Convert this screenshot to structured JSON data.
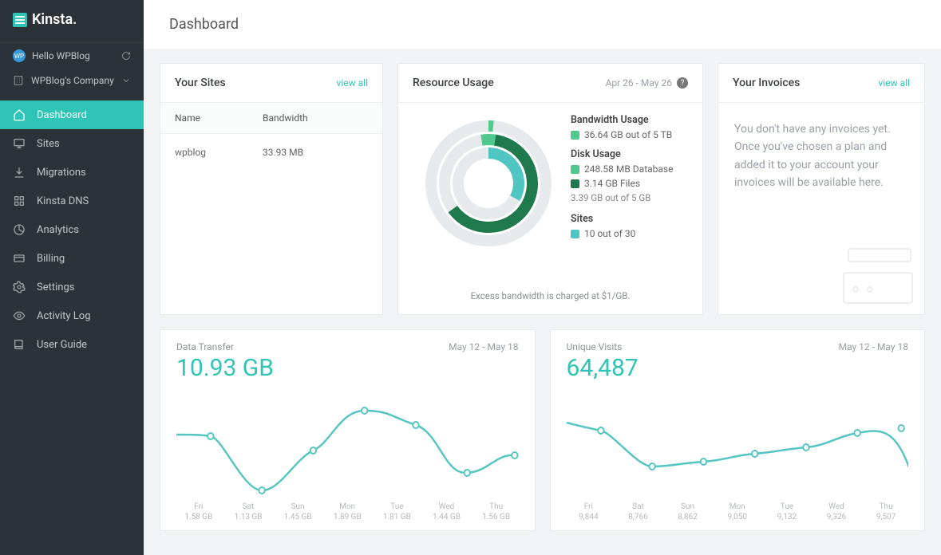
{
  "brand": {
    "name": "Kinsta."
  },
  "user": {
    "greeting": "Hello WPBlog",
    "company": "WPBlog's Company"
  },
  "nav": [
    {
      "id": "dashboard",
      "label": "Dashboard",
      "active": true
    },
    {
      "id": "sites",
      "label": "Sites",
      "active": false
    },
    {
      "id": "migrations",
      "label": "Migrations",
      "active": false
    },
    {
      "id": "kinsta-dns",
      "label": "Kinsta DNS",
      "active": false
    },
    {
      "id": "analytics",
      "label": "Analytics",
      "active": false
    },
    {
      "id": "billing",
      "label": "Billing",
      "active": false
    },
    {
      "id": "settings",
      "label": "Settings",
      "active": false
    },
    {
      "id": "activity-log",
      "label": "Activity Log",
      "active": false
    },
    {
      "id": "user-guide",
      "label": "User Guide",
      "active": false
    }
  ],
  "page_title": "Dashboard",
  "your_sites": {
    "title": "Your Sites",
    "link": "view all",
    "headers": {
      "name": "Name",
      "bandwidth": "Bandwidth"
    },
    "rows": [
      {
        "name": "wpblog",
        "bandwidth": "33.93 MB"
      }
    ]
  },
  "resource_usage": {
    "title": "Resource Usage",
    "range": "Apr 26 - May 26",
    "bandwidth": {
      "label": "Bandwidth Usage",
      "value": "36.64 GB out of 5 TB"
    },
    "disk": {
      "label": "Disk Usage",
      "database": "248.58 MB Database",
      "files": "3.14 GB Files",
      "total": "3.39 GB out of 5 GB"
    },
    "sites": {
      "label": "Sites",
      "value": "10 out of 30"
    },
    "note": "Excess bandwidth is charged at $1/GB.",
    "chart_data": {
      "type": "donut-multi",
      "rings": [
        {
          "name": "Sites",
          "used": 10,
          "total": 30,
          "color": "#50c6c2"
        },
        {
          "name": "Disk",
          "used_gb": 3.39,
          "total_gb": 5,
          "segments": [
            {
              "label": "Database",
              "value_mb": 248.58,
              "color": "#4fca8c"
            },
            {
              "label": "Files",
              "value_gb": 3.14,
              "color": "#1e7a4c"
            }
          ]
        },
        {
          "name": "Bandwidth",
          "used_gb": 36.64,
          "total_tb": 5,
          "color": "#4fca8c"
        }
      ]
    }
  },
  "your_invoices": {
    "title": "Your Invoices",
    "link": "view all",
    "empty": "You don't have any invoices yet. Once you've chosen a plan and added it to your account your invoices will be available here."
  },
  "data_transfer": {
    "title": "Data Transfer",
    "range": "May 12 - May 18",
    "total": "10.93 GB",
    "chart_data": {
      "type": "line",
      "x": [
        "Fri",
        "Sat",
        "Sun",
        "Mon",
        "Tue",
        "Wed",
        "Thu"
      ],
      "labels": [
        "1.58 GB",
        "1.13 GB",
        "1.45 GB",
        "1.89 GB",
        "1.81 GB",
        "1.44 GB",
        "1.56 GB"
      ],
      "values_gb": [
        1.58,
        1.13,
        1.45,
        1.89,
        1.81,
        1.44,
        1.56
      ]
    }
  },
  "unique_visits": {
    "title": "Unique Visits",
    "range": "May 12 - May 18",
    "total": "64,487",
    "chart_data": {
      "type": "line",
      "x": [
        "Fri",
        "Sat",
        "Sun",
        "Mon",
        "Tue",
        "Wed",
        "Thu"
      ],
      "labels": [
        "9,844",
        "8,766",
        "8,862",
        "9,050",
        "9,132",
        "9,326",
        "9,507"
      ],
      "values": [
        9844,
        8766,
        8862,
        9050,
        9132,
        9326,
        9507
      ]
    }
  }
}
